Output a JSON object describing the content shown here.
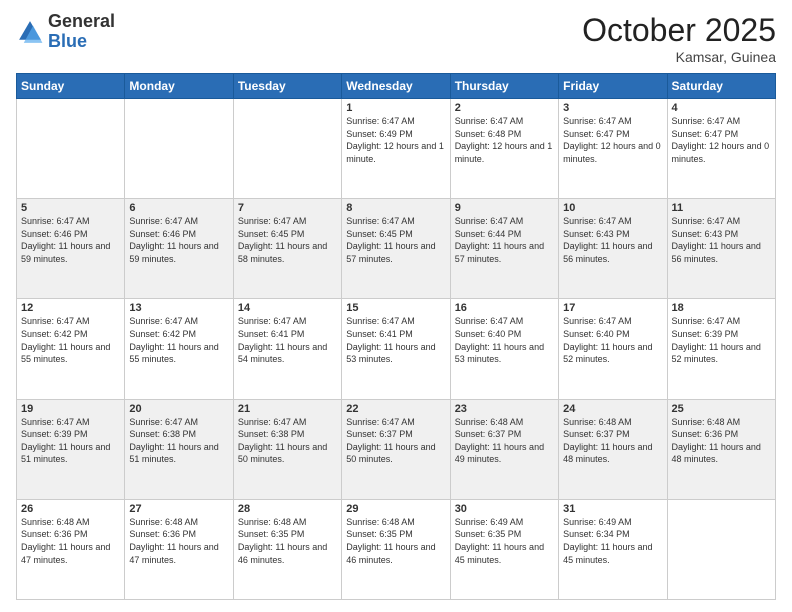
{
  "header": {
    "logo_general": "General",
    "logo_blue": "Blue",
    "month": "October 2025",
    "location": "Kamsar, Guinea"
  },
  "days_of_week": [
    "Sunday",
    "Monday",
    "Tuesday",
    "Wednesday",
    "Thursday",
    "Friday",
    "Saturday"
  ],
  "weeks": [
    [
      {
        "day": "",
        "sunrise": "",
        "sunset": "",
        "daylight": ""
      },
      {
        "day": "",
        "sunrise": "",
        "sunset": "",
        "daylight": ""
      },
      {
        "day": "",
        "sunrise": "",
        "sunset": "",
        "daylight": ""
      },
      {
        "day": "1",
        "sunrise": "Sunrise: 6:47 AM",
        "sunset": "Sunset: 6:49 PM",
        "daylight": "Daylight: 12 hours and 1 minute."
      },
      {
        "day": "2",
        "sunrise": "Sunrise: 6:47 AM",
        "sunset": "Sunset: 6:48 PM",
        "daylight": "Daylight: 12 hours and 1 minute."
      },
      {
        "day": "3",
        "sunrise": "Sunrise: 6:47 AM",
        "sunset": "Sunset: 6:47 PM",
        "daylight": "Daylight: 12 hours and 0 minutes."
      },
      {
        "day": "4",
        "sunrise": "Sunrise: 6:47 AM",
        "sunset": "Sunset: 6:47 PM",
        "daylight": "Daylight: 12 hours and 0 minutes."
      }
    ],
    [
      {
        "day": "5",
        "sunrise": "Sunrise: 6:47 AM",
        "sunset": "Sunset: 6:46 PM",
        "daylight": "Daylight: 11 hours and 59 minutes."
      },
      {
        "day": "6",
        "sunrise": "Sunrise: 6:47 AM",
        "sunset": "Sunset: 6:46 PM",
        "daylight": "Daylight: 11 hours and 59 minutes."
      },
      {
        "day": "7",
        "sunrise": "Sunrise: 6:47 AM",
        "sunset": "Sunset: 6:45 PM",
        "daylight": "Daylight: 11 hours and 58 minutes."
      },
      {
        "day": "8",
        "sunrise": "Sunrise: 6:47 AM",
        "sunset": "Sunset: 6:45 PM",
        "daylight": "Daylight: 11 hours and 57 minutes."
      },
      {
        "day": "9",
        "sunrise": "Sunrise: 6:47 AM",
        "sunset": "Sunset: 6:44 PM",
        "daylight": "Daylight: 11 hours and 57 minutes."
      },
      {
        "day": "10",
        "sunrise": "Sunrise: 6:47 AM",
        "sunset": "Sunset: 6:43 PM",
        "daylight": "Daylight: 11 hours and 56 minutes."
      },
      {
        "day": "11",
        "sunrise": "Sunrise: 6:47 AM",
        "sunset": "Sunset: 6:43 PM",
        "daylight": "Daylight: 11 hours and 56 minutes."
      }
    ],
    [
      {
        "day": "12",
        "sunrise": "Sunrise: 6:47 AM",
        "sunset": "Sunset: 6:42 PM",
        "daylight": "Daylight: 11 hours and 55 minutes."
      },
      {
        "day": "13",
        "sunrise": "Sunrise: 6:47 AM",
        "sunset": "Sunset: 6:42 PM",
        "daylight": "Daylight: 11 hours and 55 minutes."
      },
      {
        "day": "14",
        "sunrise": "Sunrise: 6:47 AM",
        "sunset": "Sunset: 6:41 PM",
        "daylight": "Daylight: 11 hours and 54 minutes."
      },
      {
        "day": "15",
        "sunrise": "Sunrise: 6:47 AM",
        "sunset": "Sunset: 6:41 PM",
        "daylight": "Daylight: 11 hours and 53 minutes."
      },
      {
        "day": "16",
        "sunrise": "Sunrise: 6:47 AM",
        "sunset": "Sunset: 6:40 PM",
        "daylight": "Daylight: 11 hours and 53 minutes."
      },
      {
        "day": "17",
        "sunrise": "Sunrise: 6:47 AM",
        "sunset": "Sunset: 6:40 PM",
        "daylight": "Daylight: 11 hours and 52 minutes."
      },
      {
        "day": "18",
        "sunrise": "Sunrise: 6:47 AM",
        "sunset": "Sunset: 6:39 PM",
        "daylight": "Daylight: 11 hours and 52 minutes."
      }
    ],
    [
      {
        "day": "19",
        "sunrise": "Sunrise: 6:47 AM",
        "sunset": "Sunset: 6:39 PM",
        "daylight": "Daylight: 11 hours and 51 minutes."
      },
      {
        "day": "20",
        "sunrise": "Sunrise: 6:47 AM",
        "sunset": "Sunset: 6:38 PM",
        "daylight": "Daylight: 11 hours and 51 minutes."
      },
      {
        "day": "21",
        "sunrise": "Sunrise: 6:47 AM",
        "sunset": "Sunset: 6:38 PM",
        "daylight": "Daylight: 11 hours and 50 minutes."
      },
      {
        "day": "22",
        "sunrise": "Sunrise: 6:47 AM",
        "sunset": "Sunset: 6:37 PM",
        "daylight": "Daylight: 11 hours and 50 minutes."
      },
      {
        "day": "23",
        "sunrise": "Sunrise: 6:48 AM",
        "sunset": "Sunset: 6:37 PM",
        "daylight": "Daylight: 11 hours and 49 minutes."
      },
      {
        "day": "24",
        "sunrise": "Sunrise: 6:48 AM",
        "sunset": "Sunset: 6:37 PM",
        "daylight": "Daylight: 11 hours and 48 minutes."
      },
      {
        "day": "25",
        "sunrise": "Sunrise: 6:48 AM",
        "sunset": "Sunset: 6:36 PM",
        "daylight": "Daylight: 11 hours and 48 minutes."
      }
    ],
    [
      {
        "day": "26",
        "sunrise": "Sunrise: 6:48 AM",
        "sunset": "Sunset: 6:36 PM",
        "daylight": "Daylight: 11 hours and 47 minutes."
      },
      {
        "day": "27",
        "sunrise": "Sunrise: 6:48 AM",
        "sunset": "Sunset: 6:36 PM",
        "daylight": "Daylight: 11 hours and 47 minutes."
      },
      {
        "day": "28",
        "sunrise": "Sunrise: 6:48 AM",
        "sunset": "Sunset: 6:35 PM",
        "daylight": "Daylight: 11 hours and 46 minutes."
      },
      {
        "day": "29",
        "sunrise": "Sunrise: 6:48 AM",
        "sunset": "Sunset: 6:35 PM",
        "daylight": "Daylight: 11 hours and 46 minutes."
      },
      {
        "day": "30",
        "sunrise": "Sunrise: 6:49 AM",
        "sunset": "Sunset: 6:35 PM",
        "daylight": "Daylight: 11 hours and 45 minutes."
      },
      {
        "day": "31",
        "sunrise": "Sunrise: 6:49 AM",
        "sunset": "Sunset: 6:34 PM",
        "daylight": "Daylight: 11 hours and 45 minutes."
      },
      {
        "day": "",
        "sunrise": "",
        "sunset": "",
        "daylight": ""
      }
    ]
  ]
}
